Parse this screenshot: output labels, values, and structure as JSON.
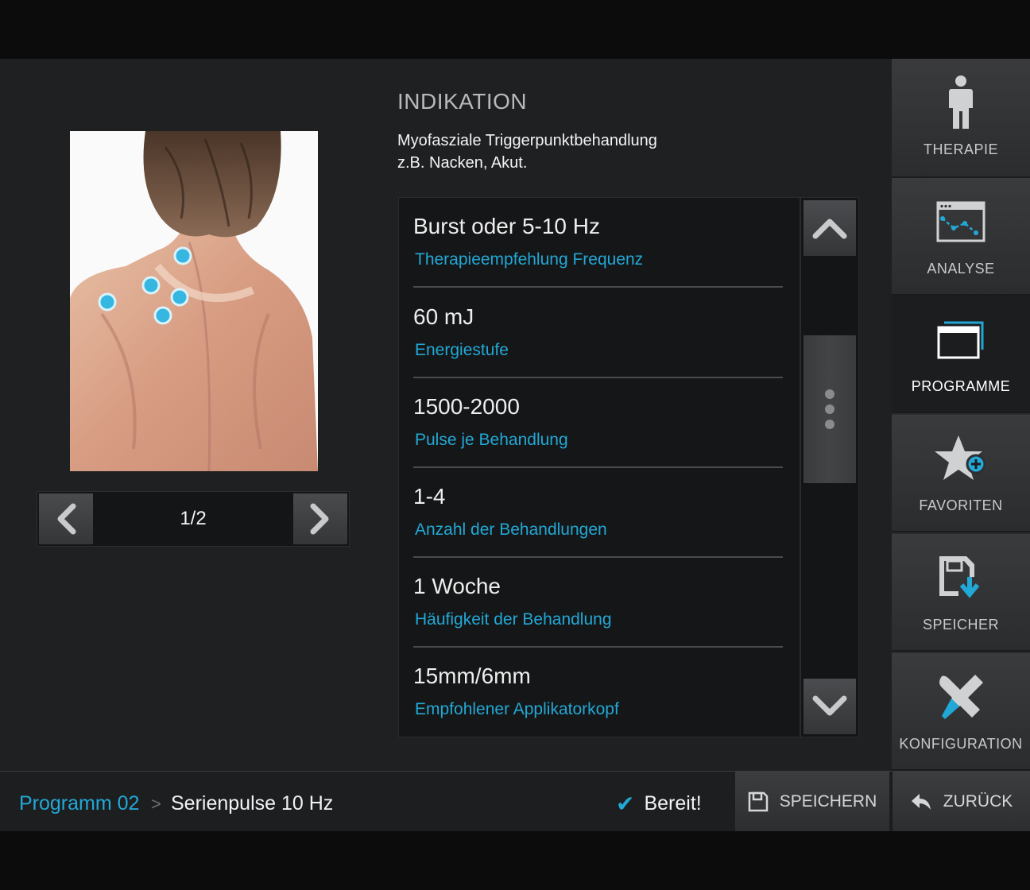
{
  "indication": {
    "title": "INDIKATION",
    "line1": "Myofasziale Triggerpunktbehandlung",
    "line2": "z.B. Nacken, Akut."
  },
  "image_pager": {
    "page": "1/2"
  },
  "parameters": [
    {
      "value": "Burst oder 5-10 Hz",
      "label": "Therapieempfehlung Frequenz"
    },
    {
      "value": "60 mJ",
      "label": "Energiestufe"
    },
    {
      "value": "1500-2000",
      "label": "Pulse je Behandlung"
    },
    {
      "value": "1-4",
      "label": "Anzahl der Behandlungen"
    },
    {
      "value": "1 Woche",
      "label": "Häufigkeit der Behandlung"
    },
    {
      "value": "15mm/6mm",
      "label": "Empfohlener Applikatorkopf"
    }
  ],
  "sidebar": {
    "items": [
      {
        "label": "THERAPIE",
        "icon": "person-icon"
      },
      {
        "label": "ANALYSE",
        "icon": "analysis-icon"
      },
      {
        "label": "PROGRAMME",
        "icon": "programs-icon",
        "active": true
      },
      {
        "label": "FAVORITEN",
        "icon": "star-plus-icon"
      },
      {
        "label": "SPEICHER",
        "icon": "save-download-icon"
      },
      {
        "label": "KONFIGURATION",
        "icon": "tools-icon"
      }
    ]
  },
  "status_bar": {
    "program": "Programm 02",
    "separator": ">",
    "program_name": "Serienpulse 10 Hz",
    "status": "Bereit!",
    "save_label": "SPEICHERN",
    "back_label": "ZURÜCK"
  },
  "colors": {
    "accent": "#22a8d6",
    "background": "#1f2022",
    "sidebar": "#2a2b2d",
    "skin": "#e7b9a0"
  }
}
